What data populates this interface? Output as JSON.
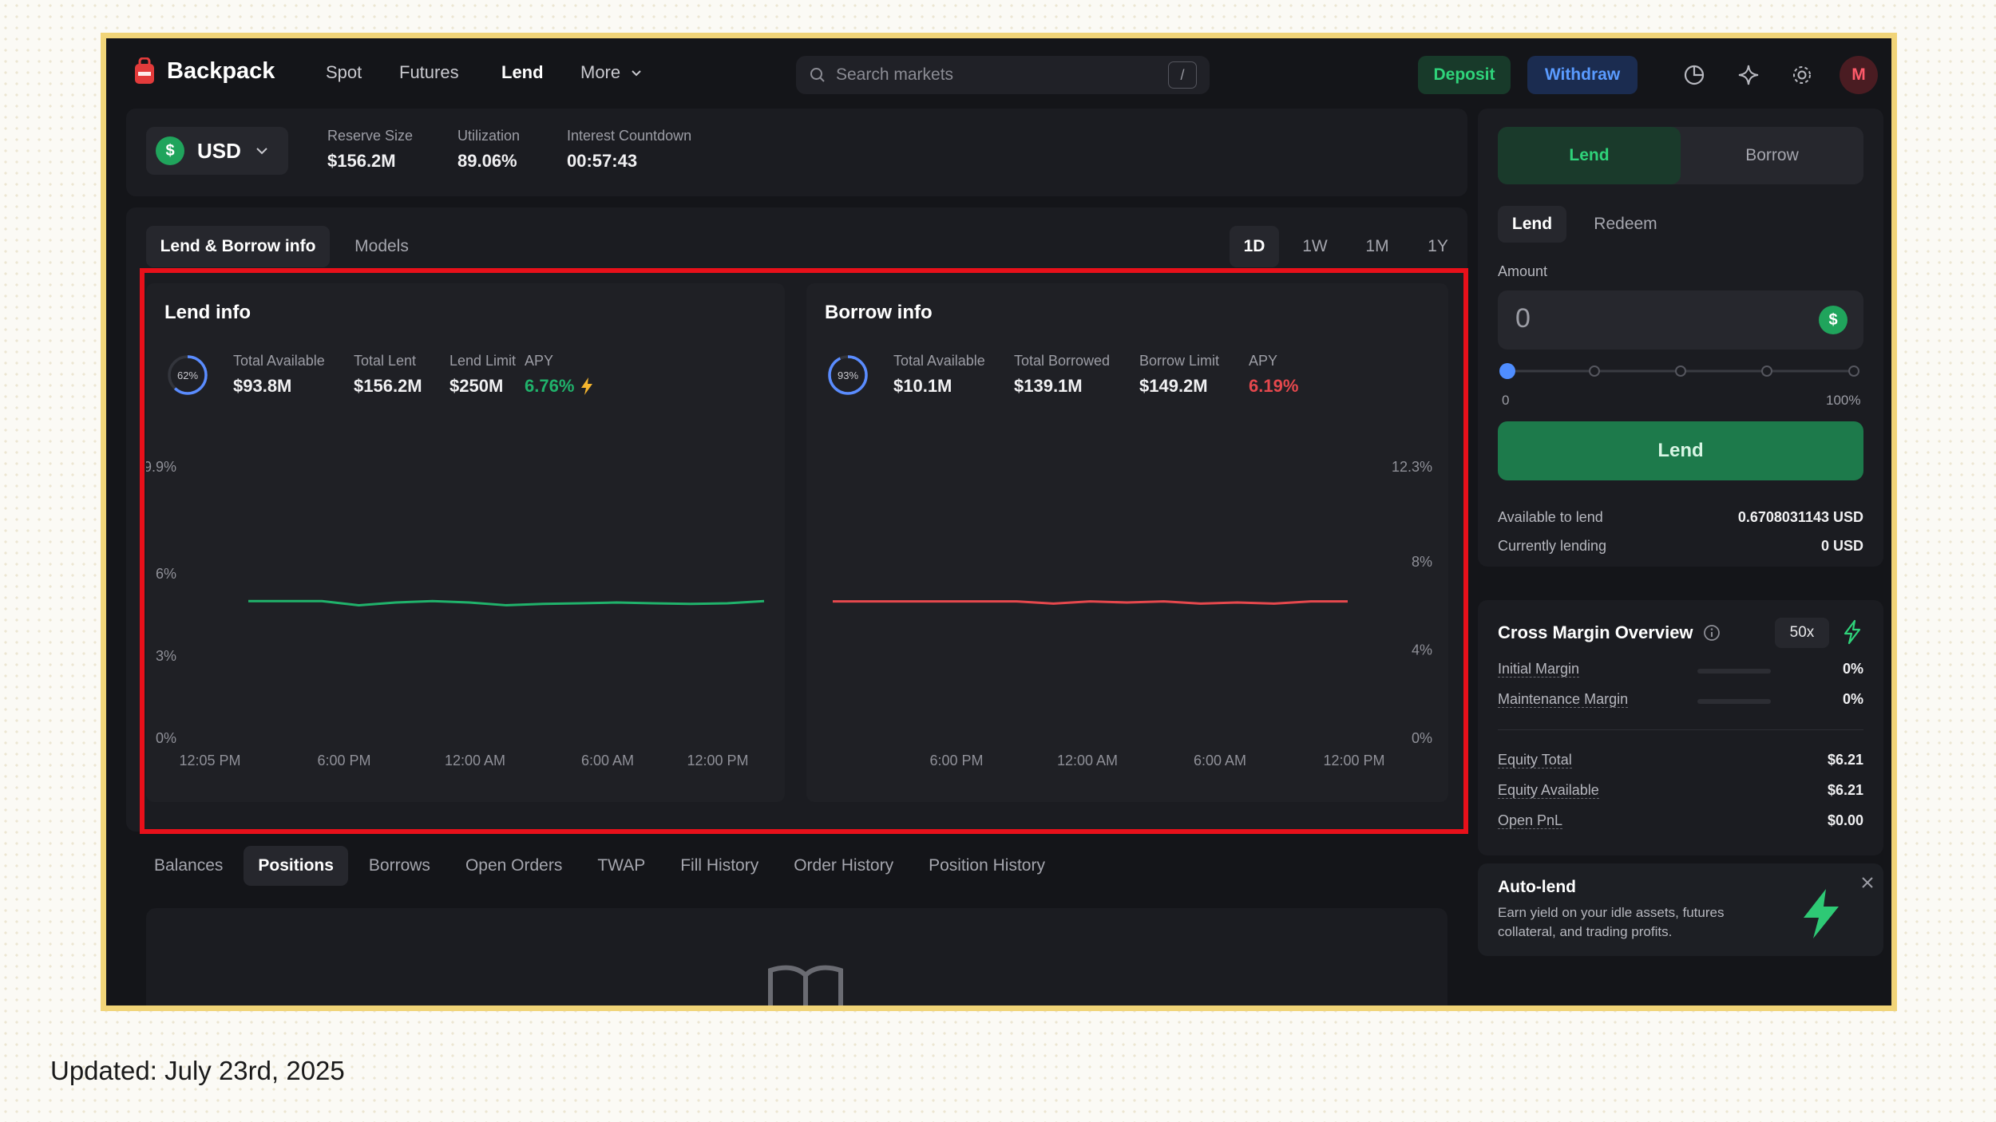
{
  "header": {
    "brand": "Backpack",
    "nav": [
      "Spot",
      "Futures",
      "Lend",
      "More"
    ],
    "search_placeholder": "Search markets",
    "search_shortcut": "/",
    "deposit": "Deposit",
    "withdraw": "Withdraw",
    "avatar": "M"
  },
  "asset": {
    "currency": "USD",
    "stats": [
      {
        "label": "Reserve Size",
        "value": "$156.2M"
      },
      {
        "label": "Utilization",
        "value": "89.06%"
      },
      {
        "label": "Interest Countdown",
        "value": "00:57:43"
      }
    ]
  },
  "info_tabs": [
    "Lend & Borrow info",
    "Models"
  ],
  "ranges": [
    "1D",
    "1W",
    "1M",
    "1Y"
  ],
  "lend_info": {
    "title": "Lend info",
    "ring": "62%",
    "stats": [
      {
        "label": "Total Available",
        "value": "$93.8M"
      },
      {
        "label": "Total Lent",
        "value": "$156.2M"
      },
      {
        "label": "Lend Limit",
        "value": "$250M"
      },
      {
        "label": "APY",
        "value": "6.76%"
      }
    ]
  },
  "borrow_info": {
    "title": "Borrow info",
    "ring": "93%",
    "stats": [
      {
        "label": "Total Available",
        "value": "$10.1M"
      },
      {
        "label": "Total Borrowed",
        "value": "$139.1M"
      },
      {
        "label": "Borrow Limit",
        "value": "$149.2M"
      },
      {
        "label": "APY",
        "value": "6.19%"
      }
    ]
  },
  "chart_data": [
    {
      "type": "line",
      "title": "Lend info",
      "x": [
        "12:05 PM",
        "6:00 PM",
        "12:00 AM",
        "6:00 AM",
        "12:00 PM"
      ],
      "y_ticks": [
        "9.9%",
        "6%",
        "3%",
        "0%"
      ],
      "ylim": [
        0,
        9.9
      ],
      "series": [
        {
          "color": "#20b26b",
          "values": [
            5.0,
            5.0,
            5.0,
            4.85,
            4.95,
            5.0,
            4.95,
            4.85,
            4.9,
            4.92,
            4.95,
            4.92,
            4.9,
            4.92,
            5.0
          ]
        }
      ]
    },
    {
      "type": "line",
      "title": "Borrow info",
      "x": [
        "6:00 PM",
        "12:00 AM",
        "6:00 AM",
        "12:00 PM"
      ],
      "y_ticks": [
        "12.3%",
        "8%",
        "4%",
        "0%"
      ],
      "ylim": [
        0,
        12.3
      ],
      "series": [
        {
          "color": "#e5484d",
          "values": [
            6.2,
            6.2,
            6.2,
            6.2,
            6.2,
            6.2,
            6.1,
            6.2,
            6.15,
            6.2,
            6.1,
            6.15,
            6.1,
            6.2,
            6.2
          ]
        }
      ]
    }
  ],
  "bottom_tabs": [
    "Balances",
    "Positions",
    "Borrows",
    "Open Orders",
    "TWAP",
    "Fill History",
    "Order History",
    "Position History"
  ],
  "lend_panel": {
    "main_tabs": [
      "Lend",
      "Borrow"
    ],
    "sub_tabs": [
      "Lend",
      "Redeem"
    ],
    "amount_label": "Amount",
    "amount_value": "0",
    "slider_min": "0",
    "slider_max": "100%",
    "slider_value": 0,
    "submit": "Lend",
    "rows": [
      {
        "label": "Available to lend",
        "value": "0.6708031143 USD"
      },
      {
        "label": "Currently lending",
        "value": "0 USD"
      }
    ]
  },
  "margin": {
    "title": "Cross Margin Overview",
    "leverage": "50x",
    "rows": [
      {
        "label": "Initial Margin",
        "value": "0%"
      },
      {
        "label": "Maintenance Margin",
        "value": "0%"
      }
    ],
    "equity": [
      {
        "label": "Equity Total",
        "value": "$6.21"
      },
      {
        "label": "Equity Available",
        "value": "$6.21"
      },
      {
        "label": "Open PnL",
        "value": "$0.00"
      }
    ]
  },
  "autolend": {
    "title": "Auto-lend",
    "line1": "Earn yield on your idle assets, futures",
    "line2": "collateral, and trading profits."
  },
  "footer": {
    "updated": "Updated: July 23rd, 2025"
  },
  "colors": {
    "accent_green": "#20b26b",
    "accent_red": "#e5484d",
    "highlight": "#e8101a",
    "frame": "#f1d478"
  }
}
